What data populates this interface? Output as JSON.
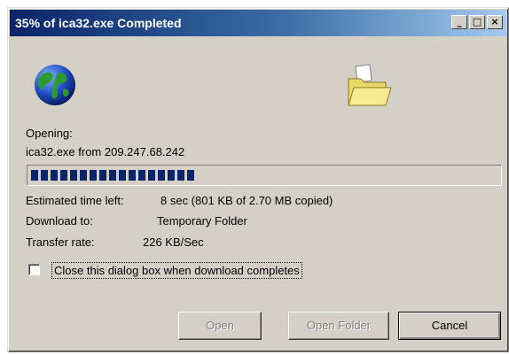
{
  "window": {
    "title": "35% of ica32.exe Completed",
    "controls": {
      "minimize": "_",
      "maximize": "□",
      "close": "×"
    }
  },
  "icons": {
    "source": "globe-icon",
    "destination": "folder-icon"
  },
  "status": {
    "opening_label": "Opening:",
    "file_line": "ica32.exe from 209.247.68.242"
  },
  "progress": {
    "percent": 35
  },
  "details": {
    "time_left_label": "Estimated time left:",
    "time_left_value": "8 sec (801 KB of 2.70 MB copied)",
    "download_to_label": "Download to:",
    "download_to_value": "Temporary Folder",
    "transfer_rate_label": "Transfer rate:",
    "transfer_rate_value": "226 KB/Sec"
  },
  "options": {
    "close_when_done_label": "Close this dialog box when download completes",
    "close_when_done_checked": false
  },
  "buttons": {
    "open": "Open",
    "open_folder": "Open Folder",
    "cancel": "Cancel"
  },
  "colors": {
    "titlebar_start": "#0a246a",
    "titlebar_end": "#a6caf0",
    "face": "#d4d0c8",
    "progress": "#0a246a"
  }
}
